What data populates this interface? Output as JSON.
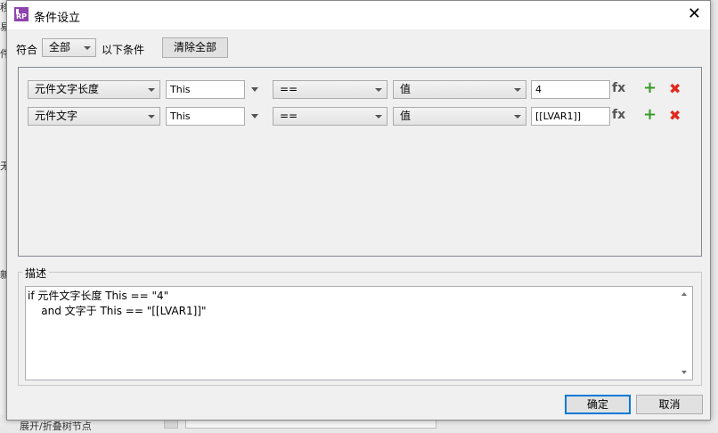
{
  "background": {
    "side_chars": [
      "移",
      "易",
      "件",
      "无",
      "新"
    ],
    "bottom_text": "展开/折叠树节点"
  },
  "dialog": {
    "title": "条件设立",
    "close_icon": "close-icon"
  },
  "match": {
    "prefix": "符合",
    "mode": "全部",
    "suffix": "以下条件",
    "clear_all": "清除全部"
  },
  "conditions": [
    {
      "target": "元件文字长度",
      "object": "This",
      "operator": "==",
      "value_type": "值",
      "value": "4"
    },
    {
      "target": "元件文字",
      "object": "This",
      "operator": "==",
      "value_type": "值",
      "value": "[[LVAR1]]"
    }
  ],
  "row_icons": {
    "fx": "fx",
    "add": "+",
    "delete": "✖"
  },
  "description": {
    "label": "描述",
    "lines": [
      "if 元件文字长度 This == \"4\"",
      "    and 文字于 This == \"[[LVAR1]]\""
    ]
  },
  "buttons": {
    "ok": "确定",
    "cancel": "取消"
  },
  "colors": {
    "accent": "#0078d7",
    "add_green": "#3a9a2a",
    "delete_red": "#e02a1e",
    "app_icon": "#8e44ad"
  }
}
